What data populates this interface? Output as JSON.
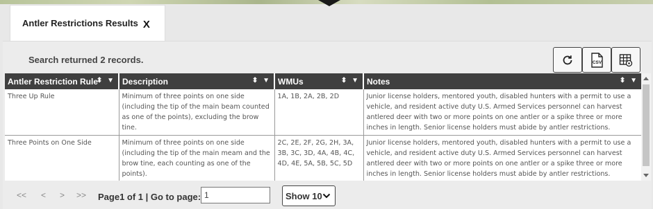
{
  "tab": {
    "label": "Antler Restrictions Results",
    "close": "X"
  },
  "status": {
    "records_text": "Search returned 2 records."
  },
  "toolbar": {
    "refresh_icon": "refresh-icon",
    "csv_icon": "csv-export-icon",
    "csv_label": "CSV",
    "table_settings_icon": "table-settings-icon"
  },
  "table": {
    "columns": [
      {
        "label": "Antler Restriction Rule"
      },
      {
        "label": "Description"
      },
      {
        "label": "WMUs"
      },
      {
        "label": "Notes"
      }
    ],
    "rows": [
      {
        "rule": "Three Up Rule",
        "description": "Minimum of three points on one side (including the tip of the main beam counted as one of the points), excluding the brow tine.",
        "wmus": "1A, 1B, 2A, 2B, 2D",
        "notes": "Junior license holders, mentored youth, disabled hunters with a permit to use a vehicle, and resident active duty U.S. Armed Services personnel can harvest antlered deer with two or more points on one antler or a spike three or more inches in length.  Senior license holders must abide by antler restrictions."
      },
      {
        "rule": "Three Points on One Side",
        "description": "Minimum of three points on one side (including the tip of the main meam and the brow tine, each counting as one of the points).",
        "wmus": "2C, 2E, 2F, 2G, 2H, 3A, 3B, 3C, 3D, 4A, 4B, 4C, 4D, 4E, 5A, 5B, 5C, 5D",
        "notes": "Junior license holders, mentored youth, disabled hunters with a permit to use a vehicle, and resident active duty U.S. Armed Services personnel can harvest antlered deer with two or more points on one antler or a spike three or more inches in length.  Senior license holders must abide by antler restrictions."
      }
    ]
  },
  "pager": {
    "first": "<<",
    "prev": "<",
    "next": ">",
    "last": ">>",
    "page_text": "Page1 of 1 | Go to page:",
    "page_input_value": "1",
    "page_size_label": "Show 10"
  }
}
